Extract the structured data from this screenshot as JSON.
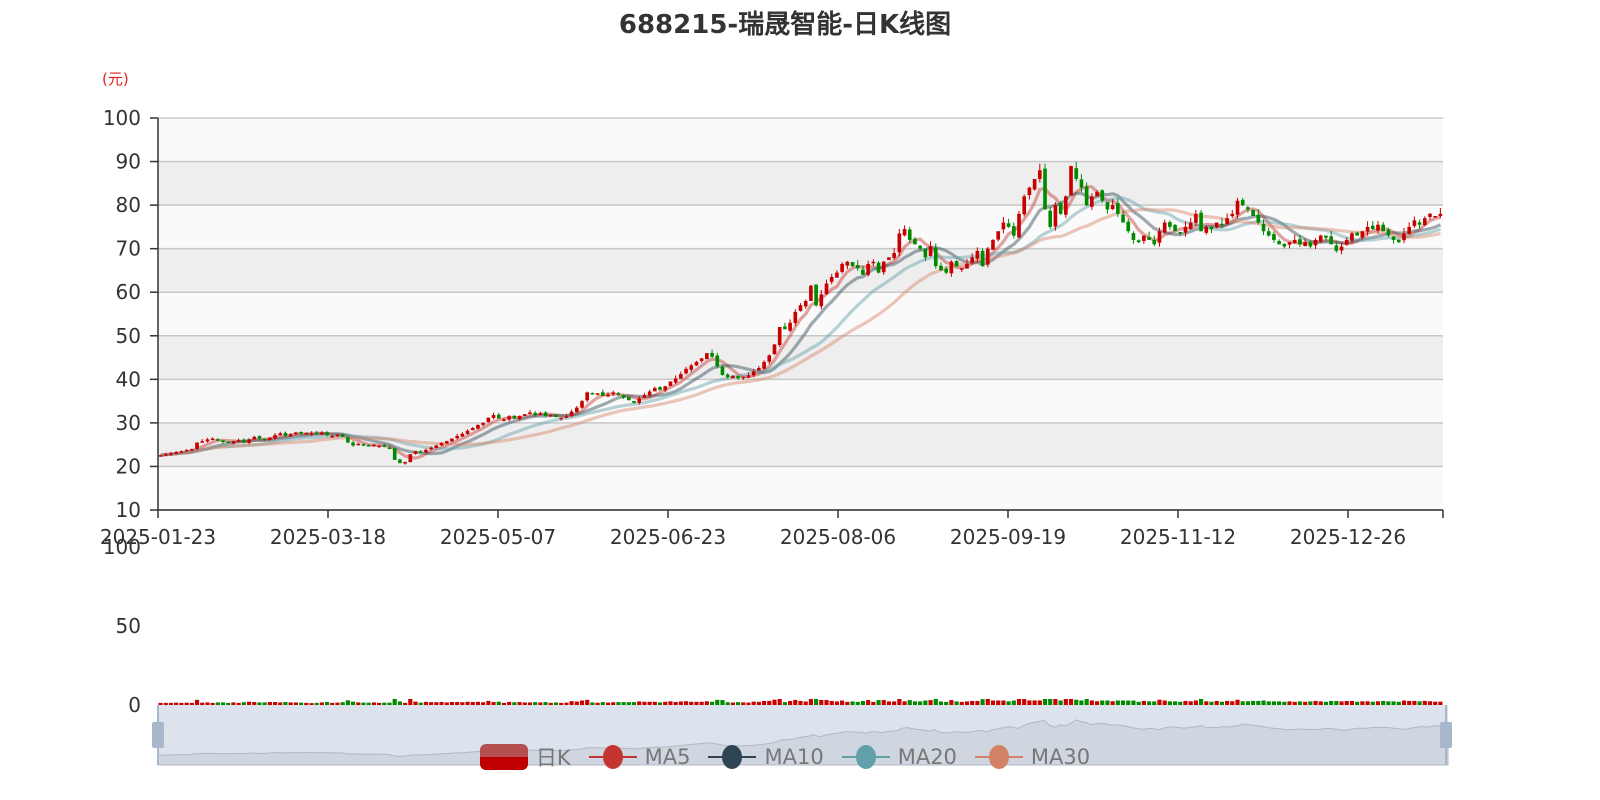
{
  "chart_data": {
    "type": "candlestick",
    "title": "688215-瑞晟智能-日K线图",
    "ylabel": "(元)",
    "ylim": [
      10,
      100
    ],
    "yticks": [
      "100",
      "90",
      "80",
      "70",
      "60",
      "50",
      "40",
      "30",
      "20",
      "10"
    ],
    "volume_yticks": [
      "100",
      "50",
      "0"
    ],
    "xticks": [
      "2025-01-23",
      "2025-03-18",
      "2025-05-07",
      "2025-06-23",
      "2025-08-06",
      "2025-09-19",
      "2025-11-12",
      "2025-12-26"
    ],
    "legend": [
      "日K",
      "MA5",
      "MA10",
      "MA20",
      "MA30"
    ],
    "colors": {
      "up": "#c80000",
      "down": "#008a00",
      "MA5": "#c23531",
      "MA10": "#2f4554",
      "MA20": "#61a0a8",
      "MA30": "#d48265"
    },
    "close": [
      22.6,
      22.8,
      23.0,
      23.3,
      23.5,
      23.8,
      24.0,
      25.5,
      25.8,
      26.2,
      26.4,
      26.0,
      25.6,
      25.4,
      25.8,
      26.0,
      25.5,
      26.2,
      26.8,
      26.4,
      26.0,
      26.6,
      27.2,
      27.6,
      27.0,
      27.4,
      27.8,
      27.5,
      27.7,
      27.6,
      27.4,
      27.8,
      27.2,
      27.0,
      27.3,
      26.8,
      25.5,
      24.8,
      25.2,
      24.9,
      24.6,
      25.0,
      24.8,
      24.5,
      24.2,
      21.5,
      20.8,
      21.0,
      22.8,
      23.5,
      23.2,
      23.8,
      24.3,
      24.8,
      25.4,
      25.8,
      26.4,
      27.0,
      27.5,
      28.2,
      28.8,
      29.5,
      30.0,
      31.2,
      31.8,
      31.0,
      30.8,
      31.5,
      31.0,
      31.6,
      32.0,
      32.4,
      31.8,
      32.2,
      31.6,
      31.8,
      31.4,
      31.2,
      31.5,
      32.6,
      33.5,
      35.0,
      37.0,
      36.6,
      36.8,
      36.2,
      36.5,
      37.0,
      36.4,
      35.8,
      35.2,
      34.6,
      35.6,
      36.4,
      37.2,
      38.0,
      37.6,
      38.4,
      39.5,
      40.2,
      41.2,
      42.4,
      43.2,
      44.0,
      44.8,
      46.0,
      45.2,
      43.0,
      41.0,
      40.5,
      40.8,
      40.2,
      40.6,
      40.9,
      41.8,
      42.6,
      44.0,
      45.5,
      48.0,
      52.0,
      51.5,
      53.0,
      55.5,
      57.0,
      58.0,
      61.5,
      57.0,
      59.5,
      62.0,
      63.5,
      64.5,
      66.5,
      67.0,
      66.0,
      65.5,
      64.0,
      66.5,
      67.0,
      64.5,
      67.0,
      68.0,
      69.0,
      73.5,
      74.5,
      72.0,
      71.0,
      70.0,
      68.0,
      70.5,
      66.0,
      65.0,
      64.5,
      67.0,
      66.0,
      65.5,
      66.5,
      68.0,
      69.5,
      66.0,
      70.0,
      72.0,
      74.0,
      76.0,
      75.0,
      73.0,
      78.0,
      82.0,
      84.0,
      86.0,
      88.0,
      79.0,
      75.0,
      80.0,
      78.0,
      82.0,
      89.0,
      86.0,
      84.0,
      80.0,
      82.0,
      83.0,
      81.0,
      79.0,
      80.0,
      78.0,
      76.0,
      74.0,
      72.0,
      71.5,
      73.0,
      72.0,
      71.0,
      74.0,
      76.0,
      75.0,
      74.0,
      73.5,
      75.0,
      76.0,
      78.0,
      74.0,
      75.0,
      74.5,
      76.0,
      75.5,
      77.0,
      78.0,
      81.0,
      80.0,
      79.0,
      77.5,
      76.0,
      74.0,
      73.0,
      72.0,
      71.0,
      70.5,
      71.5,
      72.0,
      71.0,
      71.5,
      70.5,
      72.0,
      73.0,
      72.5,
      71.0,
      69.5,
      70.5,
      72.0,
      73.5,
      73.0,
      74.0,
      75.0,
      74.5,
      75.5,
      74.0,
      73.0,
      72.0,
      71.5,
      73.5,
      75.0,
      76.5,
      75.5,
      77.0,
      78.0,
      77.5,
      78.0
    ]
  }
}
